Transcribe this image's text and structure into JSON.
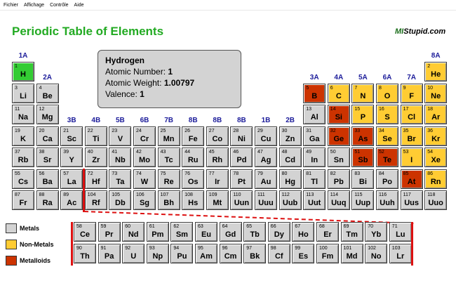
{
  "menu": [
    "Fichier",
    "Affichage",
    "Contrôle",
    "Aide"
  ],
  "title": "Periodic Table of Elements",
  "logo": {
    "a": "MI",
    "b": "Stupid.com"
  },
  "info": {
    "name": "Hydrogen",
    "number_label": "Atomic Number:",
    "number": "1",
    "weight_label": "Atomic Weight:",
    "weight": "1.00797",
    "valence_label": "Valence:",
    "valence": "1"
  },
  "groups": [
    "1A",
    "2A",
    "3B",
    "4B",
    "5B",
    "6B",
    "7B",
    "8B",
    "8B",
    "8B",
    "1B",
    "2B",
    "3A",
    "4A",
    "5A",
    "6A",
    "7A",
    "8A"
  ],
  "colors": {
    "metal": "#d3d3d3",
    "nonmetal": "#ffcc33",
    "metalloid": "#cc3300",
    "selected": "#33cc33",
    "group_label": "#1c1c9a",
    "title": "#22aa22"
  },
  "elements": [
    {
      "n": "1",
      "s": "H",
      "c": "selected"
    },
    {
      "n": "2",
      "s": "He",
      "c": "nonmetal"
    },
    {
      "n": "3",
      "s": "Li",
      "c": "metal"
    },
    {
      "n": "4",
      "s": "Be",
      "c": "metal"
    },
    {
      "n": "5",
      "s": "B",
      "c": "metalloid"
    },
    {
      "n": "6",
      "s": "C",
      "c": "nonmetal"
    },
    {
      "n": "7",
      "s": "N",
      "c": "nonmetal"
    },
    {
      "n": "8",
      "s": "O",
      "c": "nonmetal"
    },
    {
      "n": "9",
      "s": "F",
      "c": "nonmetal"
    },
    {
      "n": "10",
      "s": "Ne",
      "c": "nonmetal"
    },
    {
      "n": "11",
      "s": "Na",
      "c": "metal"
    },
    {
      "n": "12",
      "s": "Mg",
      "c": "metal"
    },
    {
      "n": "13",
      "s": "Al",
      "c": "metal"
    },
    {
      "n": "14",
      "s": "Si",
      "c": "metalloid"
    },
    {
      "n": "15",
      "s": "P",
      "c": "nonmetal"
    },
    {
      "n": "16",
      "s": "S",
      "c": "nonmetal"
    },
    {
      "n": "17",
      "s": "Cl",
      "c": "nonmetal"
    },
    {
      "n": "18",
      "s": "Ar",
      "c": "nonmetal"
    },
    {
      "n": "19",
      "s": "K",
      "c": "metal"
    },
    {
      "n": "20",
      "s": "Ca",
      "c": "metal"
    },
    {
      "n": "21",
      "s": "Sc",
      "c": "metal"
    },
    {
      "n": "22",
      "s": "Ti",
      "c": "metal"
    },
    {
      "n": "23",
      "s": "V",
      "c": "metal"
    },
    {
      "n": "24",
      "s": "Cr",
      "c": "metal"
    },
    {
      "n": "25",
      "s": "Mn",
      "c": "metal"
    },
    {
      "n": "26",
      "s": "Fe",
      "c": "metal"
    },
    {
      "n": "27",
      "s": "Co",
      "c": "metal"
    },
    {
      "n": "28",
      "s": "Ni",
      "c": "metal"
    },
    {
      "n": "29",
      "s": "Cu",
      "c": "metal"
    },
    {
      "n": "30",
      "s": "Zn",
      "c": "metal"
    },
    {
      "n": "31",
      "s": "Ga",
      "c": "metal"
    },
    {
      "n": "32",
      "s": "Ge",
      "c": "metalloid"
    },
    {
      "n": "33",
      "s": "As",
      "c": "metalloid"
    },
    {
      "n": "34",
      "s": "Se",
      "c": "nonmetal"
    },
    {
      "n": "35",
      "s": "Br",
      "c": "nonmetal"
    },
    {
      "n": "36",
      "s": "Kr",
      "c": "nonmetal"
    },
    {
      "n": "37",
      "s": "Rb",
      "c": "metal"
    },
    {
      "n": "38",
      "s": "Sr",
      "c": "metal"
    },
    {
      "n": "39",
      "s": "Y",
      "c": "metal"
    },
    {
      "n": "40",
      "s": "Zr",
      "c": "metal"
    },
    {
      "n": "41",
      "s": "Nb",
      "c": "metal"
    },
    {
      "n": "42",
      "s": "Mo",
      "c": "metal"
    },
    {
      "n": "43",
      "s": "Tc",
      "c": "metal"
    },
    {
      "n": "44",
      "s": "Ru",
      "c": "metal"
    },
    {
      "n": "45",
      "s": "Rh",
      "c": "metal"
    },
    {
      "n": "46",
      "s": "Pd",
      "c": "metal"
    },
    {
      "n": "47",
      "s": "Ag",
      "c": "metal"
    },
    {
      "n": "48",
      "s": "Cd",
      "c": "metal"
    },
    {
      "n": "49",
      "s": "In",
      "c": "metal"
    },
    {
      "n": "50",
      "s": "Sn",
      "c": "metal"
    },
    {
      "n": "51",
      "s": "Sb",
      "c": "metalloid"
    },
    {
      "n": "52",
      "s": "Te",
      "c": "metalloid"
    },
    {
      "n": "53",
      "s": "I",
      "c": "nonmetal"
    },
    {
      "n": "54",
      "s": "Xe",
      "c": "nonmetal"
    },
    {
      "n": "55",
      "s": "Cs",
      "c": "metal"
    },
    {
      "n": "56",
      "s": "Ba",
      "c": "metal"
    },
    {
      "n": "57",
      "s": "La",
      "c": "metal"
    },
    {
      "n": "72",
      "s": "Hf",
      "c": "metal"
    },
    {
      "n": "73",
      "s": "Ta",
      "c": "metal"
    },
    {
      "n": "74",
      "s": "W",
      "c": "metal"
    },
    {
      "n": "75",
      "s": "Re",
      "c": "metal"
    },
    {
      "n": "76",
      "s": "Os",
      "c": "metal"
    },
    {
      "n": "77",
      "s": "Ir",
      "c": "metal"
    },
    {
      "n": "78",
      "s": "Pt",
      "c": "metal"
    },
    {
      "n": "79",
      "s": "Au",
      "c": "metal"
    },
    {
      "n": "80",
      "s": "Hg",
      "c": "metal"
    },
    {
      "n": "81",
      "s": "Tl",
      "c": "metal"
    },
    {
      "n": "82",
      "s": "Pb",
      "c": "metal"
    },
    {
      "n": "83",
      "s": "Bi",
      "c": "metal"
    },
    {
      "n": "84",
      "s": "Po",
      "c": "metal"
    },
    {
      "n": "85",
      "s": "At",
      "c": "metalloid"
    },
    {
      "n": "86",
      "s": "Rn",
      "c": "nonmetal"
    },
    {
      "n": "87",
      "s": "Fr",
      "c": "metal"
    },
    {
      "n": "88",
      "s": "Ra",
      "c": "metal"
    },
    {
      "n": "89",
      "s": "Ac",
      "c": "metal"
    },
    {
      "n": "104",
      "s": "Rf",
      "c": "metal"
    },
    {
      "n": "105",
      "s": "Db",
      "c": "metal"
    },
    {
      "n": "106",
      "s": "Sg",
      "c": "metal"
    },
    {
      "n": "107",
      "s": "Bh",
      "c": "metal"
    },
    {
      "n": "108",
      "s": "Hs",
      "c": "metal"
    },
    {
      "n": "109",
      "s": "Mt",
      "c": "metal"
    },
    {
      "n": "110",
      "s": "Uun",
      "c": "metal"
    },
    {
      "n": "111",
      "s": "Uuu",
      "c": "metal"
    },
    {
      "n": "112",
      "s": "Uub",
      "c": "metal"
    },
    {
      "n": "113",
      "s": "Uut",
      "c": "metal"
    },
    {
      "n": "114",
      "s": "Uuq",
      "c": "metal"
    },
    {
      "n": "115",
      "s": "Uup",
      "c": "metal"
    },
    {
      "n": "116",
      "s": "Uuh",
      "c": "metal"
    },
    {
      "n": "117",
      "s": "Uus",
      "c": "metal"
    },
    {
      "n": "118",
      "s": "Uuo",
      "c": "metal"
    },
    {
      "n": "58",
      "s": "Ce",
      "c": "metal"
    },
    {
      "n": "59",
      "s": "Pr",
      "c": "metal"
    },
    {
      "n": "60",
      "s": "Nd",
      "c": "metal"
    },
    {
      "n": "61",
      "s": "Pm",
      "c": "metal"
    },
    {
      "n": "62",
      "s": "Sm",
      "c": "metal"
    },
    {
      "n": "63",
      "s": "Eu",
      "c": "metal"
    },
    {
      "n": "64",
      "s": "Gd",
      "c": "metal"
    },
    {
      "n": "65",
      "s": "Tb",
      "c": "metal"
    },
    {
      "n": "66",
      "s": "Dy",
      "c": "metal"
    },
    {
      "n": "67",
      "s": "Ho",
      "c": "metal"
    },
    {
      "n": "68",
      "s": "Er",
      "c": "metal"
    },
    {
      "n": "69",
      "s": "Tm",
      "c": "metal"
    },
    {
      "n": "70",
      "s": "Yb",
      "c": "metal"
    },
    {
      "n": "71",
      "s": "Lu",
      "c": "metal"
    },
    {
      "n": "90",
      "s": "Th",
      "c": "metal"
    },
    {
      "n": "91",
      "s": "Pa",
      "c": "metal"
    },
    {
      "n": "92",
      "s": "U",
      "c": "metal"
    },
    {
      "n": "93",
      "s": "Np",
      "c": "metal"
    },
    {
      "n": "94",
      "s": "Pu",
      "c": "metal"
    },
    {
      "n": "95",
      "s": "Am",
      "c": "metal"
    },
    {
      "n": "96",
      "s": "Cm",
      "c": "metal"
    },
    {
      "n": "97",
      "s": "Bk",
      "c": "metal"
    },
    {
      "n": "98",
      "s": "Cf",
      "c": "metal"
    },
    {
      "n": "99",
      "s": "Es",
      "c": "metal"
    },
    {
      "n": "100",
      "s": "Fm",
      "c": "metal"
    },
    {
      "n": "101",
      "s": "Md",
      "c": "metal"
    },
    {
      "n": "102",
      "s": "No",
      "c": "metal"
    },
    {
      "n": "103",
      "s": "Lr",
      "c": "metal"
    }
  ],
  "legend": [
    {
      "label": "Metals",
      "c": "metal"
    },
    {
      "label": "Non-Metals",
      "c": "nonmetal"
    },
    {
      "label": "Metalloids",
      "c": "metalloid"
    }
  ]
}
